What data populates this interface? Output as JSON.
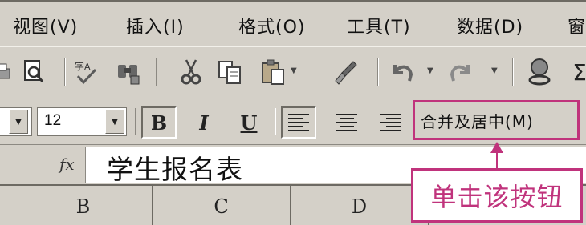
{
  "menu": {
    "items": [
      {
        "label": "视图(V)"
      },
      {
        "label": "插入(I)"
      },
      {
        "label": "格式(O)"
      },
      {
        "label": "工具(T)"
      },
      {
        "label": "数据(D)"
      },
      {
        "label": "窗"
      }
    ]
  },
  "toolbar1": {
    "icons": [
      "print-preview-icon",
      "spelling-icon",
      "research-icon",
      "cut-icon",
      "copy-icon",
      "paste-icon",
      "format-painter-icon",
      "undo-icon",
      "redo-icon",
      "hyperlink-icon",
      "autosum-icon"
    ]
  },
  "format_toolbar": {
    "font_size": "12",
    "bold_label": "B",
    "italic_label": "I",
    "underline_label": "U",
    "merge_center_label": "合并及居中(M)"
  },
  "formula_bar": {
    "fx_label": "fx",
    "value": "学生报名表"
  },
  "columns": {
    "headers": [
      "B",
      "C",
      "D"
    ]
  },
  "annotation": {
    "callout_text": "单击该按钮",
    "accent_color": "#c0337c"
  }
}
